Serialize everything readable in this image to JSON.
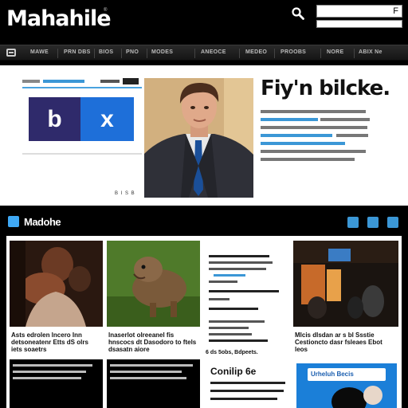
{
  "header": {
    "logo": "Mahahile",
    "logo_mark": "®",
    "search_placeholder": "",
    "search_value": "F"
  },
  "nav": {
    "items": [
      "MAWE",
      "PRN DBS",
      "BIOS",
      "PNO",
      "MODES",
      "ANEOCE",
      "MEDEO",
      "PROOBS",
      "NORE",
      "ABIX Ne"
    ]
  },
  "hero": {
    "promo_left": "b",
    "promo_right": "x",
    "title": "Fiy'n bilcke.",
    "caption": "B I S B"
  },
  "section": {
    "title": "Madohe"
  },
  "cards": [
    {
      "caption": "Asts edrolen lncero Inn detsoneatenr Etts dS olrs iets soaetrs"
    },
    {
      "caption": "lnaserlot olreeanel fis hnscocs dt Dasodoro to ftels dsasatn aiore"
    },
    {
      "caption": "6 ds 5obs, Bdpeets."
    },
    {
      "caption": "Mlcis dlsdan ar s bl Ssstie Cestioncto dasr fsleaes Ebot leos"
    }
  ],
  "bottom": {
    "title": "Conilip 6e",
    "ad_label": "Urheluh Becis"
  }
}
